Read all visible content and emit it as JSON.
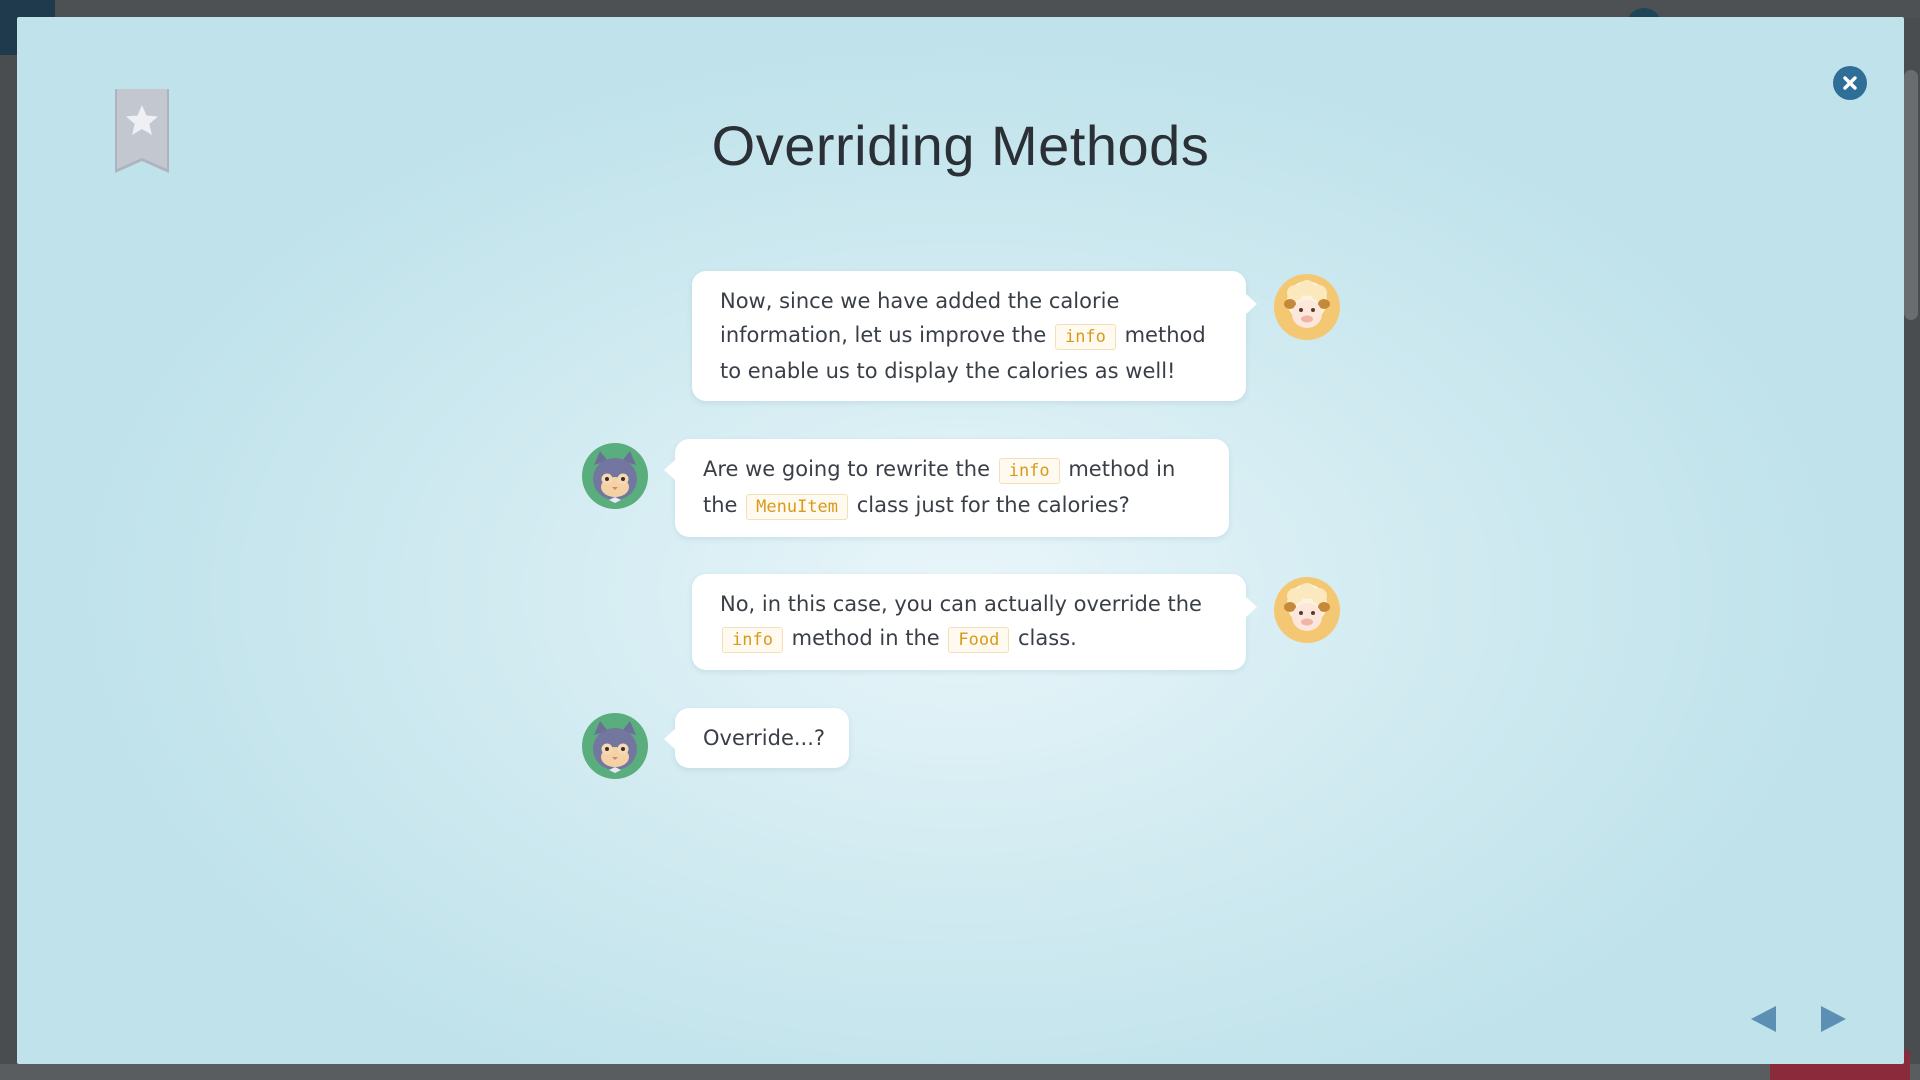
{
  "modal": {
    "title": "Overriding Methods",
    "icons": {
      "bookmark": "bookmark-star-icon",
      "close": "close-icon",
      "prev": "triangle-left-icon",
      "next": "triangle-right-icon"
    },
    "colors": {
      "close_button": "#2f6e97",
      "nav_arrows": "#5b8fb3",
      "code_text": "#d99a1c",
      "bubble_text": "#3a3f47"
    }
  },
  "dialogue": [
    {
      "speaker": "sheep",
      "side": "right",
      "parts": [
        {
          "type": "text",
          "value": "Now, since we have added the calorie information, let us improve the "
        },
        {
          "type": "code",
          "value": "info"
        },
        {
          "type": "text",
          "value": " method to enable us to display the calories as well!"
        }
      ]
    },
    {
      "speaker": "cat",
      "side": "left",
      "parts": [
        {
          "type": "text",
          "value": "Are we going to rewrite the "
        },
        {
          "type": "code",
          "value": "info"
        },
        {
          "type": "text",
          "value": " method in the "
        },
        {
          "type": "code",
          "value": "MenuItem"
        },
        {
          "type": "text",
          "value": " class just for the calories?"
        }
      ]
    },
    {
      "speaker": "sheep",
      "side": "right",
      "parts": [
        {
          "type": "text",
          "value": "No, in this case, you can actually override the "
        },
        {
          "type": "code",
          "value": "info"
        },
        {
          "type": "text",
          "value": " method in the "
        },
        {
          "type": "code",
          "value": "Food"
        },
        {
          "type": "text",
          "value": " class."
        }
      ]
    },
    {
      "speaker": "cat",
      "side": "left",
      "parts": [
        {
          "type": "text",
          "value": "Override...?"
        }
      ]
    }
  ]
}
